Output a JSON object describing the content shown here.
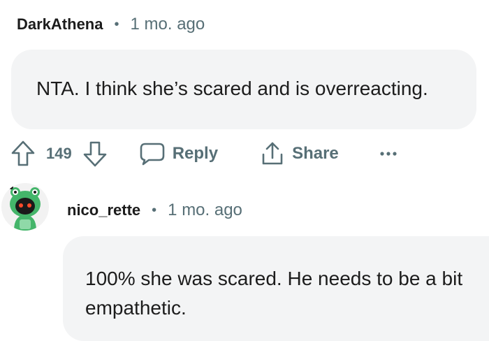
{
  "comments": [
    {
      "author": "DarkAthena",
      "separator": "•",
      "time": "1 mo. ago",
      "body": "NTA. I think she’s scared and is overreacting.",
      "score": "149",
      "actions": {
        "reply_label": "Reply",
        "share_label": "Share",
        "more_label": "•••"
      }
    },
    {
      "author": "nico_rette",
      "separator": "•",
      "time": "1 mo. ago",
      "body_line1": "100% she was scared. He needs to be a bit",
      "body_line2": "empathetic."
    }
  ],
  "colors": {
    "bubble_bg": "#f3f4f5",
    "meta_text": "#576f76",
    "avatar_green": "#44b56a"
  },
  "icons": {
    "upvote": "arrow-up-icon",
    "downvote": "arrow-down-icon",
    "reply": "speech-bubble-icon",
    "share": "share-icon",
    "more": "ellipsis-icon",
    "avatar": "snoo-frog-avatar"
  }
}
